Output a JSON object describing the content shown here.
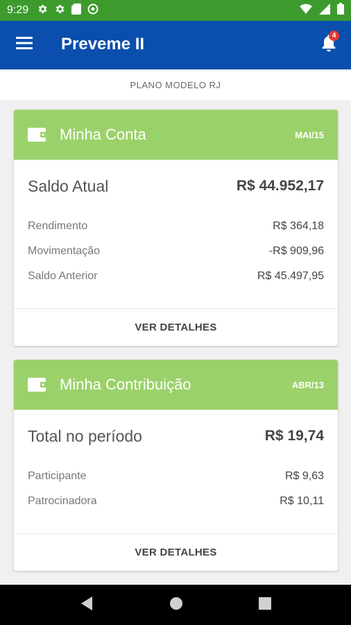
{
  "status_bar": {
    "time": "9:29"
  },
  "app_bar": {
    "title": "Preveme II",
    "notification_count": "4"
  },
  "subheader": {
    "text": "PLANO MODELO RJ"
  },
  "card_account": {
    "title": "Minha Conta",
    "date": "MAI/15",
    "main_label": "Saldo Atual",
    "main_value": "R$ 44.952,17",
    "rows": [
      {
        "label": "Rendimento",
        "value": "R$ 364,18"
      },
      {
        "label": "Movimentação",
        "value": "-R$ 909,96"
      },
      {
        "label": "Saldo Anterior",
        "value": "R$ 45.497,95"
      }
    ],
    "footer": "VER DETALHES"
  },
  "card_contribution": {
    "title": "Minha Contribuição",
    "date": "ABR/13",
    "main_label": "Total no período",
    "main_value": "R$ 19,74",
    "rows": [
      {
        "label": "Participante",
        "value": "R$ 9,63"
      },
      {
        "label": "Patrocinadora",
        "value": "R$ 10,11"
      }
    ],
    "footer": "VER DETALHES"
  },
  "colors": {
    "status_bar": "#3d9b2e",
    "app_bar": "#0a4fad",
    "card_header": "#9bd16a",
    "badge": "#e53935"
  },
  "icons": [
    "gear-icon",
    "sd-card-icon",
    "sync-icon",
    "wifi-icon",
    "signal-icon",
    "battery-icon",
    "menu-icon",
    "bell-icon",
    "wallet-icon",
    "back-icon",
    "home-icon",
    "recents-icon"
  ]
}
